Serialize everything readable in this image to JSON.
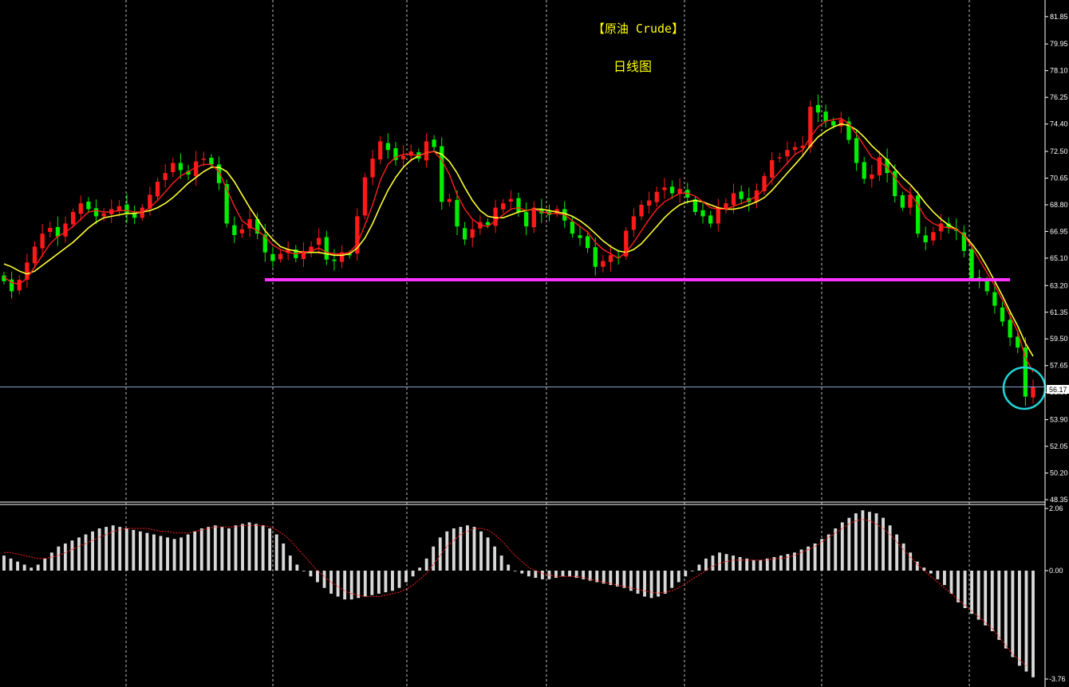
{
  "header": {
    "title": "【原油 Crude】",
    "subtitle": "日线图"
  },
  "colors": {
    "background": "#000000",
    "bull_candle": "#ff1a1a",
    "bear_candle": "#00ee00",
    "ma_fast": "#ff2020",
    "ma_slow": "#ffff33",
    "support_line": "#ff33ff",
    "highlight_circle": "#22d3d3",
    "macd_bar": "#d8d8d8",
    "signal_line": "#ff2020",
    "axis_text": "#ffffff",
    "title_text": "#ffff00",
    "grid": "#ffffff"
  },
  "chart_data": [
    {
      "type": "candlestick",
      "title": "【原油 Crude】",
      "subtitle": "日线图",
      "ylim": [
        48.35,
        83.0
      ],
      "ytick_labels": [
        "81.85",
        "79.95",
        "78.10",
        "76.25",
        "74.40",
        "72.50",
        "70.65",
        "68.80",
        "66.95",
        "65.10",
        "63.20",
        "61.35",
        "59.50",
        "57.65",
        "55.80",
        "53.90",
        "52.05",
        "50.20",
        "48.35"
      ],
      "current_price_label": "56.17",
      "current_price": 56.17,
      "support_level": 63.6,
      "highlight": "last two candles",
      "close_series": [
        63.5,
        62.8,
        63.6,
        64.8,
        65.9,
        66.8,
        67.2,
        66.6,
        67.5,
        68.3,
        68.9,
        68.5,
        68.0,
        68.2,
        68.5,
        68.7,
        68.2,
        67.9,
        68.6,
        69.5,
        70.4,
        71.0,
        71.7,
        71.2,
        70.9,
        71.8,
        72.0,
        71.6,
        70.3,
        67.5,
        66.7,
        67.1,
        67.8,
        66.8,
        65.5,
        64.9,
        65.4,
        65.7,
        65.1,
        65.6,
        65.9,
        66.5,
        65.0,
        64.9,
        65.5,
        65.3,
        68.0,
        70.7,
        72.0,
        73.2,
        72.6,
        71.9,
        72.2,
        72.5,
        72.0,
        73.2,
        72.8,
        69.0,
        69.2,
        67.3,
        66.4,
        67.1,
        67.6,
        67.4,
        68.6,
        68.9,
        69.2,
        68.3,
        67.3,
        68.6,
        68.2,
        68.1,
        68.5,
        67.7,
        66.8,
        66.5,
        65.8,
        64.5,
        64.9,
        65.3,
        65.1,
        67.0,
        68.0,
        68.8,
        69.1,
        69.7,
        70.0,
        69.6,
        69.9,
        69.3,
        68.3,
        68.0,
        67.5,
        68.6,
        68.9,
        69.6,
        69.2,
        69.0,
        69.8,
        70.8,
        71.9,
        72.1,
        72.6,
        72.8,
        72.9,
        75.6,
        75.2,
        74.6,
        74.3,
        74.7,
        73.3,
        71.7,
        70.6,
        70.9,
        72.1,
        71.0,
        69.4,
        68.6,
        69.5,
        66.8,
        66.2,
        66.9,
        67.5,
        67.2,
        67.0,
        65.6,
        63.7,
        63.5,
        62.8,
        61.8,
        60.7,
        59.6,
        58.9,
        55.5,
        56.2
      ],
      "ma_fast_series": [
        63.8,
        63.4,
        63.3,
        63.7,
        64.5,
        65.3,
        66.1,
        66.6,
        66.9,
        67.3,
        67.8,
        68.3,
        68.4,
        68.3,
        68.3,
        68.4,
        68.4,
        68.3,
        68.3,
        68.6,
        69.1,
        69.7,
        70.3,
        70.8,
        71.1,
        71.4,
        71.6,
        71.6,
        71.1,
        69.9,
        68.7,
        67.7,
        67.3,
        67.0,
        66.6,
        66.0,
        65.7,
        65.5,
        65.4,
        65.5,
        65.6,
        65.8,
        65.5,
        65.4,
        65.4,
        65.5,
        66.1,
        67.4,
        68.8,
        70.5,
        71.6,
        72.1,
        72.3,
        72.3,
        72.2,
        72.4,
        72.5,
        71.9,
        70.9,
        69.5,
        68.5,
        67.8,
        67.4,
        67.3,
        67.7,
        68.1,
        68.5,
        68.6,
        68.4,
        68.5,
        68.3,
        68.2,
        68.2,
        68.1,
        67.7,
        67.3,
        66.9,
        66.2,
        65.7,
        65.4,
        65.1,
        65.5,
        66.2,
        67.0,
        67.8,
        68.5,
        69.0,
        69.3,
        69.6,
        69.6,
        69.4,
        69.0,
        68.6,
        68.5,
        68.5,
        68.7,
        68.9,
        69.1,
        69.4,
        69.9,
        70.5,
        71.1,
        71.7,
        72.3,
        72.6,
        73.5,
        74.2,
        74.6,
        74.7,
        74.8,
        74.4,
        73.7,
        72.9,
        72.1,
        71.8,
        71.4,
        70.7,
        70.0,
        69.6,
        68.8,
        67.9,
        67.5,
        67.3,
        67.2,
        67.1,
        66.7,
        65.9,
        65.0,
        64.1,
        63.2,
        62.2,
        61.1,
        60.0,
        58.2,
        57.2
      ],
      "ma_slow_series": [
        64.7,
        64.5,
        64.2,
        64.0,
        64.2,
        64.6,
        65.0,
        65.4,
        65.8,
        66.2,
        66.7,
        67.2,
        67.6,
        67.9,
        68.0,
        68.1,
        68.2,
        68.2,
        68.3,
        68.4,
        68.6,
        68.9,
        69.3,
        69.8,
        70.3,
        70.7,
        71.1,
        71.4,
        71.4,
        71.1,
        70.4,
        69.5,
        68.6,
        67.8,
        67.0,
        66.4,
        65.9,
        65.7,
        65.6,
        65.5,
        65.5,
        65.5,
        65.4,
        65.3,
        65.3,
        65.4,
        65.8,
        66.5,
        67.5,
        68.7,
        69.8,
        70.7,
        71.4,
        71.9,
        72.2,
        72.4,
        72.5,
        72.3,
        71.8,
        71.0,
        70.0,
        69.1,
        68.4,
        68.0,
        67.9,
        67.9,
        68.1,
        68.3,
        68.4,
        68.5,
        68.5,
        68.4,
        68.3,
        68.2,
        68.0,
        67.7,
        67.3,
        66.8,
        66.3,
        65.9,
        65.6,
        65.5,
        65.7,
        66.1,
        66.7,
        67.3,
        67.9,
        68.4,
        68.8,
        69.0,
        69.1,
        69.0,
        68.8,
        68.6,
        68.5,
        68.5,
        68.6,
        68.8,
        69.0,
        69.3,
        69.8,
        70.4,
        71.0,
        71.6,
        72.2,
        72.9,
        73.5,
        73.9,
        74.2,
        74.4,
        74.3,
        74.0,
        73.5,
        72.9,
        72.4,
        71.9,
        71.3,
        70.7,
        70.2,
        69.6,
        68.9,
        68.3,
        67.8,
        67.4,
        67.1,
        66.7,
        66.1,
        65.4,
        64.5,
        63.5,
        62.5,
        61.4,
        60.4,
        59.2,
        58.3
      ]
    },
    {
      "type": "bar",
      "title": "",
      "ylim": [
        -3.76,
        2.06
      ],
      "ytick_labels": [
        "2.06",
        "0.00",
        "-3.76"
      ],
      "histogram": [
        0.5,
        0.4,
        0.3,
        0.2,
        0.1,
        0.2,
        0.4,
        0.6,
        0.8,
        0.9,
        1.0,
        1.1,
        1.2,
        1.3,
        1.4,
        1.45,
        1.5,
        1.45,
        1.4,
        1.35,
        1.3,
        1.25,
        1.2,
        1.15,
        1.1,
        1.05,
        1.1,
        1.2,
        1.3,
        1.4,
        1.45,
        1.5,
        1.45,
        1.4,
        1.5,
        1.55,
        1.6,
        1.55,
        1.5,
        1.4,
        1.2,
        0.9,
        0.5,
        0.2,
        0.0,
        -0.2,
        -0.4,
        -0.6,
        -0.8,
        -0.9,
        -1.0,
        -1.0,
        -0.95,
        -0.9,
        -0.85,
        -0.8,
        -0.75,
        -0.7,
        -0.6,
        -0.4,
        -0.2,
        0.1,
        0.4,
        0.8,
        1.1,
        1.3,
        1.4,
        1.45,
        1.5,
        1.45,
        1.3,
        1.1,
        0.8,
        0.5,
        0.2,
        0.0,
        -0.1,
        -0.2,
        -0.25,
        -0.3,
        -0.3,
        -0.25,
        -0.2,
        -0.2,
        -0.25,
        -0.3,
        -0.35,
        -0.4,
        -0.45,
        -0.5,
        -0.55,
        -0.6,
        -0.7,
        -0.8,
        -0.9,
        -0.95,
        -0.9,
        -0.8,
        -0.6,
        -0.4,
        -0.2,
        0.0,
        0.2,
        0.4,
        0.5,
        0.6,
        0.55,
        0.5,
        0.45,
        0.4,
        0.35,
        0.35,
        0.4,
        0.45,
        0.5,
        0.55,
        0.6,
        0.7,
        0.8,
        0.9,
        1.05,
        1.2,
        1.4,
        1.6,
        1.75,
        1.9,
        2.0,
        1.95,
        1.9,
        1.75,
        1.5,
        1.2,
        0.9,
        0.6,
        0.3,
        0.1,
        -0.1,
        -0.3,
        -0.5,
        -0.8,
        -1.1,
        -1.3,
        -1.5,
        -1.7,
        -1.9,
        -2.1,
        -2.4,
        -2.7,
        -3.0,
        -3.3,
        -3.5,
        -3.7
      ],
      "signal_series": [
        0.6,
        0.6,
        0.55,
        0.5,
        0.45,
        0.4,
        0.4,
        0.45,
        0.5,
        0.6,
        0.7,
        0.8,
        0.9,
        1.0,
        1.1,
        1.2,
        1.3,
        1.35,
        1.4,
        1.4,
        1.4,
        1.4,
        1.35,
        1.3,
        1.3,
        1.25,
        1.25,
        1.25,
        1.3,
        1.35,
        1.4,
        1.45,
        1.45,
        1.45,
        1.45,
        1.5,
        1.5,
        1.5,
        1.5,
        1.45,
        1.35,
        1.2,
        1.0,
        0.75,
        0.5,
        0.25,
        0.0,
        -0.2,
        -0.4,
        -0.55,
        -0.7,
        -0.8,
        -0.85,
        -0.9,
        -0.9,
        -0.9,
        -0.85,
        -0.8,
        -0.75,
        -0.65,
        -0.5,
        -0.3,
        -0.1,
        0.2,
        0.5,
        0.8,
        1.0,
        1.2,
        1.3,
        1.4,
        1.4,
        1.35,
        1.2,
        1.0,
        0.75,
        0.5,
        0.3,
        0.1,
        0.0,
        -0.1,
        -0.15,
        -0.2,
        -0.2,
        -0.2,
        -0.2,
        -0.25,
        -0.3,
        -0.35,
        -0.4,
        -0.45,
        -0.5,
        -0.55,
        -0.6,
        -0.65,
        -0.7,
        -0.75,
        -0.78,
        -0.75,
        -0.7,
        -0.6,
        -0.45,
        -0.3,
        -0.15,
        0.0,
        0.15,
        0.25,
        0.3,
        0.35,
        0.35,
        0.35,
        0.35,
        0.35,
        0.35,
        0.4,
        0.4,
        0.45,
        0.5,
        0.6,
        0.7,
        0.8,
        0.95,
        1.1,
        1.25,
        1.4,
        1.55,
        1.65,
        1.7,
        1.65,
        1.55,
        1.4,
        1.2,
        0.95,
        0.7,
        0.45,
        0.2,
        0.0,
        -0.2,
        -0.4,
        -0.6,
        -0.8,
        -1.0,
        -1.2,
        -1.4,
        -1.6,
        -1.8,
        -2.0,
        -2.3,
        -2.6,
        -2.9,
        -3.1,
        -3.3
      ]
    }
  ]
}
